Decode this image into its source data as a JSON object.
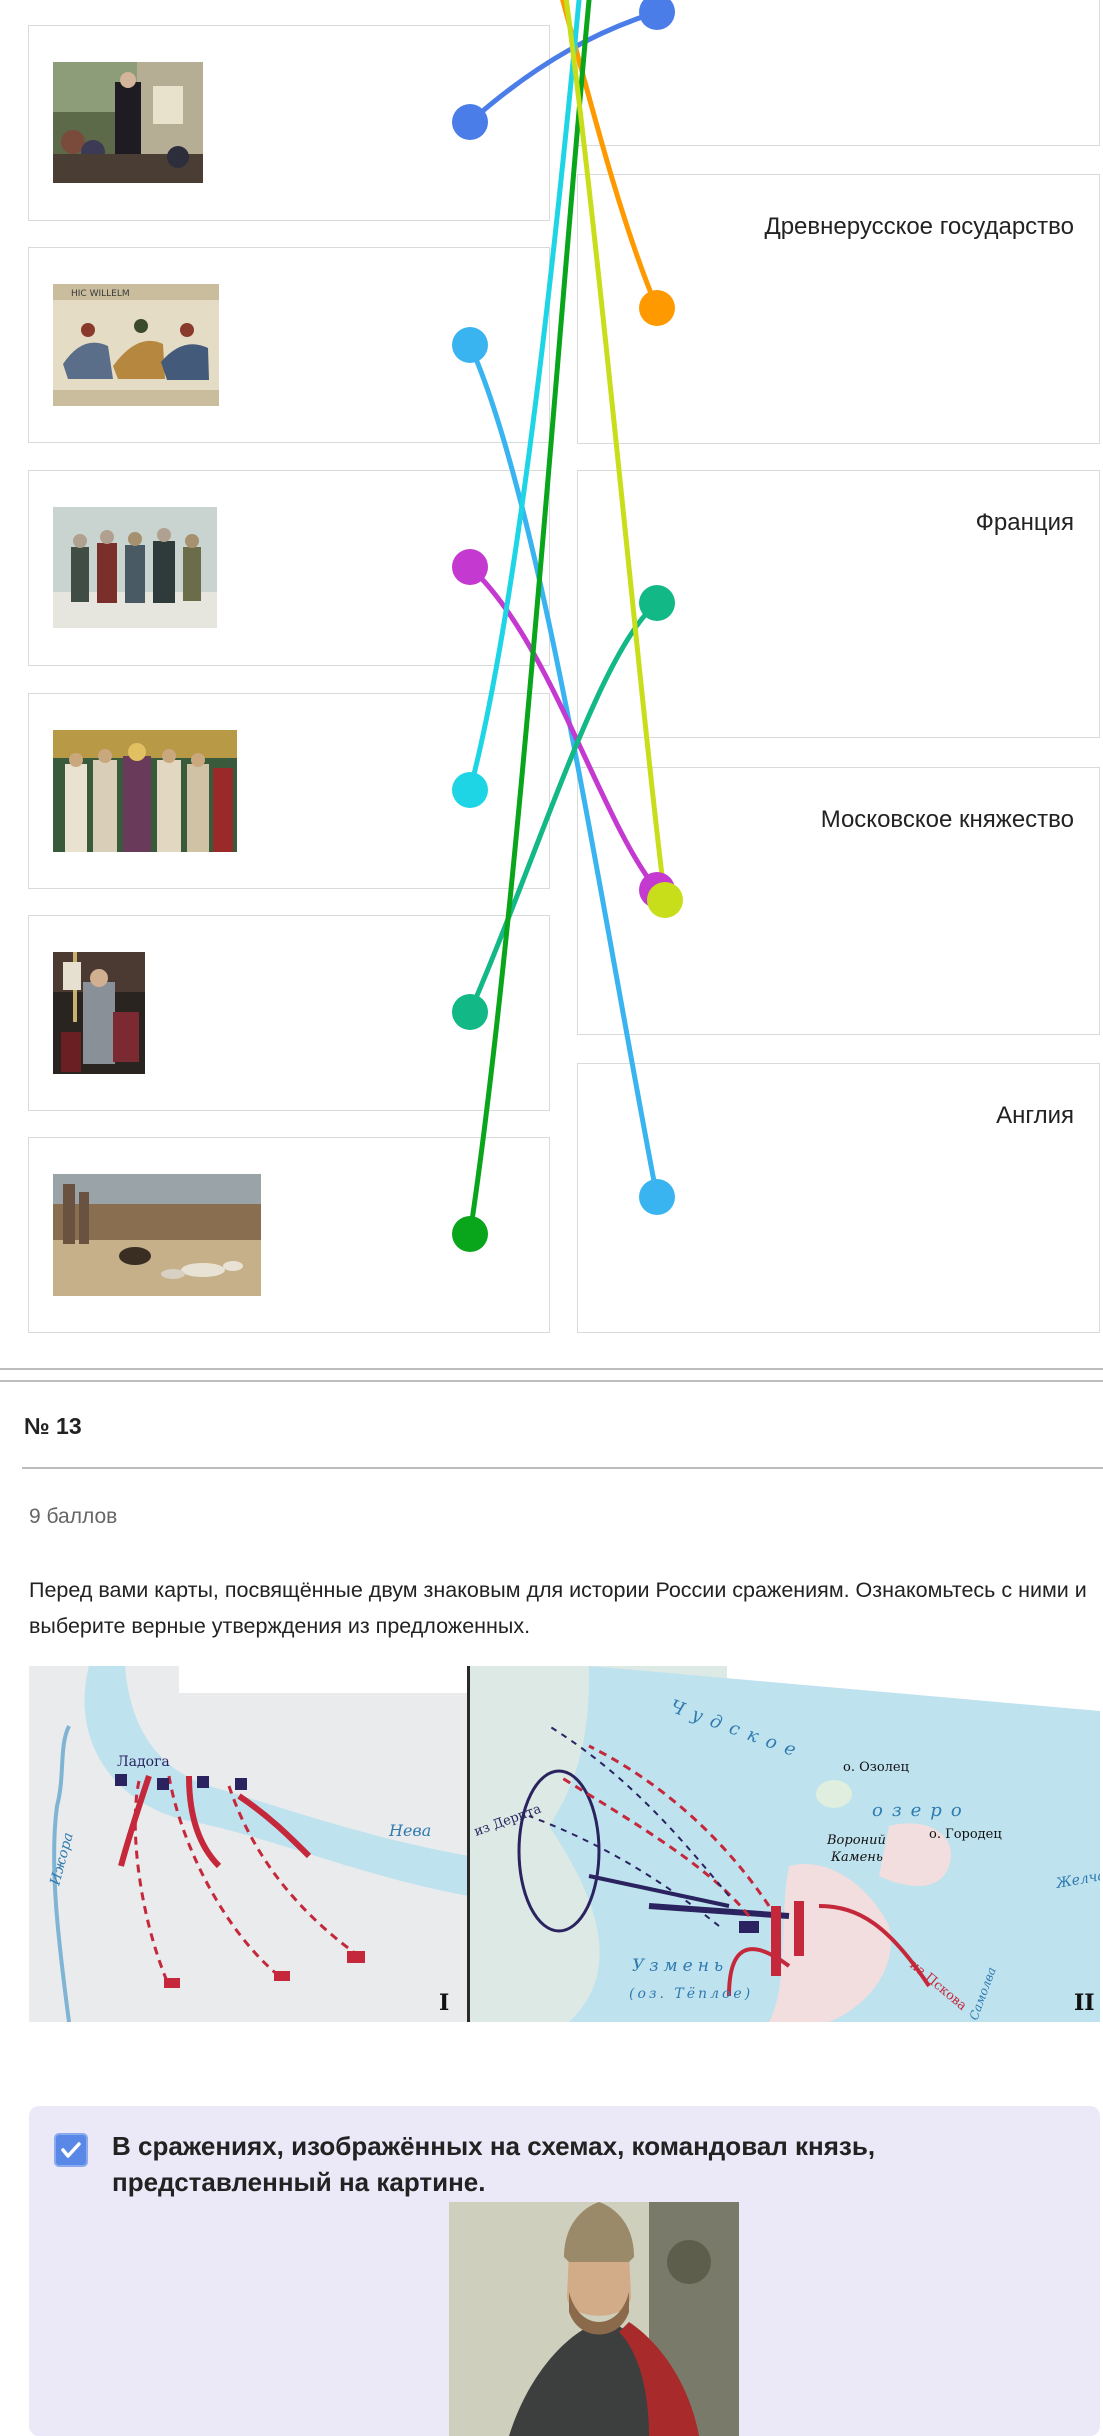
{
  "matching": {
    "left_items": [
      {
        "image": "luther-theses-painting"
      },
      {
        "image": "bayeux-tapestry"
      },
      {
        "image": "medieval-warriors-painting"
      },
      {
        "image": "byzantine-mosaic"
      },
      {
        "image": "joan-of-arc-painting"
      },
      {
        "image": "colosseum-painting"
      }
    ],
    "right_items": [
      {
        "label": ""
      },
      {
        "label": "Древнерусское государство"
      },
      {
        "label": "Франция"
      },
      {
        "label": "Московское княжество"
      },
      {
        "label": "Англия"
      }
    ],
    "line_colors": [
      "#4a7de8",
      "#ff9900",
      "#3ab4f0",
      "#c43ad0",
      "#1ed5e6",
      "#12b886",
      "#09a51a",
      "#c8de1a"
    ]
  },
  "question": {
    "number": "№ 13",
    "points": "9 баллов",
    "text": "Перед вами карты, посвящённые двум знаковым для истории России сражениям. Ознакомьтесь с ними и выберите верные утверждения из предложенных."
  },
  "maps": {
    "map1": {
      "labels": [
        "Нева",
        "Ижора",
        "Ладога"
      ],
      "numeral": "I"
    },
    "map2": {
      "labels": [
        "Чудское",
        "озеро",
        "о. Озолец",
        "о. Городец",
        "Вороний",
        "Камень",
        "Узмень",
        "(оз. Тёплое)",
        "из Дерпта",
        "из Пскова",
        "Желча",
        "Самолва"
      ],
      "numeral": "II"
    }
  },
  "answer": {
    "checked": true,
    "text": "В сражениях, изображённых на схемах, командовал князь, представленный на картине.",
    "image": "prince-alexander-nevsky-painting"
  },
  "colors": {
    "checkbox": "#5a88e6",
    "answer_bg": "#ebe9f7",
    "lake": "#bfe2ef",
    "arrow_red": "#c4283a",
    "arrow_navy": "#2a2360"
  }
}
